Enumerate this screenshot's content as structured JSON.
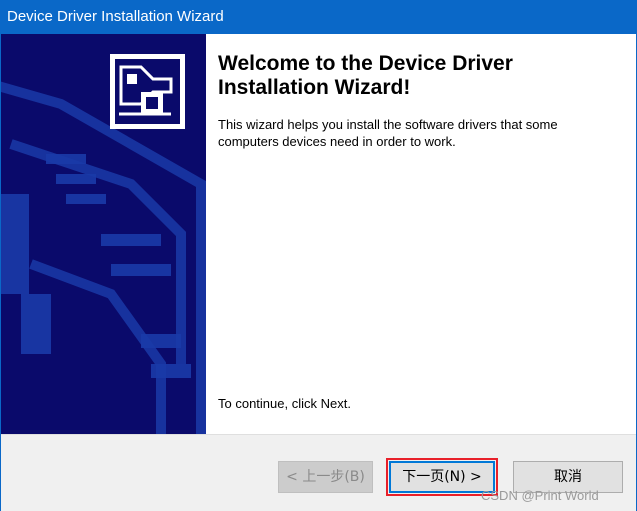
{
  "window": {
    "title": "Device Driver Installation Wizard",
    "accent": "#0a68c8",
    "banner_color": "#0a0a6b"
  },
  "content": {
    "heading_line1": "Welcome to the Device Driver",
    "heading_line2": "Installation Wizard!",
    "intro_line1": "This wizard helps you install the software drivers that some",
    "intro_line2": "computers devices need in order to work.",
    "continue_text": "To continue, click Next."
  },
  "buttons": {
    "back_label": "< 上一步(B)",
    "next_label": "下一页(N) >",
    "cancel_label": "取消"
  },
  "watermark": "CSDN @Print World",
  "icons": {
    "banner_icon": "device-driver-icon"
  }
}
